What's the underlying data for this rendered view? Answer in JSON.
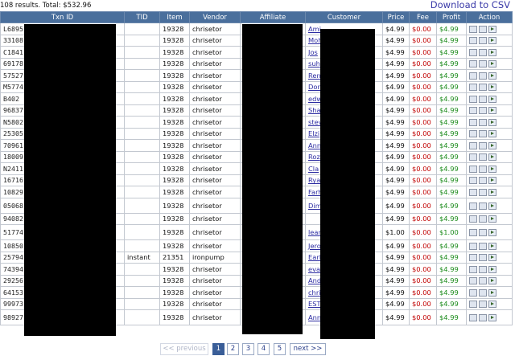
{
  "summary": "108 results. Total: $532.96",
  "download_label": "Download to CSV",
  "columns": [
    "Txn ID",
    "TID",
    "Item",
    "Vendor",
    "Affiliate",
    "Customer",
    "Price",
    "Fee",
    "Profit",
    "Action"
  ],
  "rows": [
    {
      "txn": "L6895",
      "tid": "",
      "item": "19328",
      "vendor": "chrisetor",
      "customer": "Ami",
      "price": "$4.99",
      "fee": "$0.00",
      "profit": "$4.99",
      "tall": false
    },
    {
      "txn": "33108",
      "tid": "",
      "item": "19328",
      "vendor": "chrisetor",
      "customer": "Moh",
      "price": "$4.99",
      "fee": "$0.00",
      "profit": "$4.99",
      "tall": false
    },
    {
      "txn": "C1841",
      "tid": "",
      "item": "19328",
      "vendor": "chrisetor",
      "customer": "Jos",
      "price": "$4.99",
      "fee": "$0.00",
      "profit": "$4.99",
      "tall": false
    },
    {
      "txn": "69178",
      "tid": "",
      "item": "19328",
      "vendor": "chrisetor",
      "customer": "suh",
      "price": "$4.99",
      "fee": "$0.00",
      "profit": "$4.99",
      "tall": false
    },
    {
      "txn": "57527",
      "tid": "",
      "item": "19328",
      "vendor": "chrisetor",
      "customer": "Ren",
      "price": "$4.99",
      "fee": "$0.00",
      "profit": "$4.99",
      "tall": false
    },
    {
      "txn": "M5774",
      "tid": "",
      "item": "19328",
      "vendor": "chrisetor",
      "customer": "Don",
      "price": "$4.99",
      "fee": "$0.00",
      "profit": "$4.99",
      "tall": false
    },
    {
      "txn": "B402",
      "tid": "",
      "item": "19328",
      "vendor": "chrisetor",
      "customer": "edw",
      "price": "$4.99",
      "fee": "$0.00",
      "profit": "$4.99",
      "tall": false
    },
    {
      "txn": "96837",
      "tid": "",
      "item": "19328",
      "vendor": "chrisetor",
      "customer": "Sha",
      "price": "$4.99",
      "fee": "$0.00",
      "profit": "$4.99",
      "tall": false
    },
    {
      "txn": "N5802",
      "tid": "",
      "item": "19328",
      "vendor": "chrisetor",
      "customer": "stev",
      "price": "$4.99",
      "fee": "$0.00",
      "profit": "$4.99",
      "tall": false
    },
    {
      "txn": "25305",
      "tid": "",
      "item": "19328",
      "vendor": "chrisetor",
      "customer": "Elzi",
      "price": "$4.99",
      "fee": "$0.00",
      "profit": "$4.99",
      "tall": false
    },
    {
      "txn": "70961",
      "tid": "",
      "item": "19328",
      "vendor": "chrisetor",
      "customer": "Ann",
      "price": "$4.99",
      "fee": "$0.00",
      "profit": "$4.99",
      "tall": false
    },
    {
      "txn": "18009",
      "tid": "",
      "item": "19328",
      "vendor": "chrisetor",
      "customer": "Roz",
      "price": "$4.99",
      "fee": "$0.00",
      "profit": "$4.99",
      "tall": false
    },
    {
      "txn": "N2411",
      "tid": "",
      "item": "19328",
      "vendor": "chrisetor",
      "customer": "Cla",
      "price": "$4.99",
      "fee": "$0.00",
      "profit": "$4.99",
      "tall": false
    },
    {
      "txn": "16716",
      "tid": "",
      "item": "19328",
      "vendor": "chrisetor",
      "customer": "Rya",
      "price": "$4.99",
      "fee": "$0.00",
      "profit": "$4.99",
      "tall": false
    },
    {
      "txn": "10829",
      "tid": "",
      "item": "19328",
      "vendor": "chrisetor",
      "customer": "Farh",
      "price": "$4.99",
      "fee": "$0.00",
      "profit": "$4.99",
      "tall": false
    },
    {
      "txn": "05068",
      "tid": "",
      "item": "19328",
      "vendor": "chrisetor",
      "customer": "Dim Muh",
      "price": "$4.99",
      "fee": "$0.00",
      "profit": "$4.99",
      "tall": true
    },
    {
      "txn": "94082",
      "tid": "",
      "item": "19328",
      "vendor": "chrisetor",
      "customer": "",
      "price": "$4.99",
      "fee": "$0.00",
      "profit": "$4.99",
      "tall": false
    },
    {
      "txn": "51774",
      "tid": "",
      "item": "19328",
      "vendor": "chrisetor",
      "customer": "lean sant",
      "price": "$1.00",
      "fee": "$0.00",
      "profit": "$1.00",
      "tall": true
    },
    {
      "txn": "10850",
      "tid": "",
      "item": "19328",
      "vendor": "chrisetor",
      "customer": "Jero",
      "price": "$4.99",
      "fee": "$0.00",
      "profit": "$4.99",
      "tall": false
    },
    {
      "txn": "25794",
      "tid": "instant",
      "item": "21351",
      "vendor": "ironpump",
      "customer": "Earl",
      "price": "$4.99",
      "fee": "$0.00",
      "profit": "$4.99",
      "tall": false
    },
    {
      "txn": "74394",
      "tid": "",
      "item": "19328",
      "vendor": "chrisetor",
      "customer": "eva",
      "price": "$4.99",
      "fee": "$0.00",
      "profit": "$4.99",
      "tall": false
    },
    {
      "txn": "29256",
      "tid": "",
      "item": "19328",
      "vendor": "chrisetor",
      "customer": "And",
      "price": "$4.99",
      "fee": "$0.00",
      "profit": "$4.99",
      "tall": false
    },
    {
      "txn": "64153",
      "tid": "",
      "item": "19328",
      "vendor": "chrisetor",
      "customer": "chri",
      "price": "$4.99",
      "fee": "$0.00",
      "profit": "$4.99",
      "tall": false
    },
    {
      "txn": "99973",
      "tid": "",
      "item": "19328",
      "vendor": "chrisetor",
      "customer": "EST",
      "price": "$4.99",
      "fee": "$0.00",
      "profit": "$4.99",
      "tall": false
    },
    {
      "txn": "98927",
      "tid": "",
      "item": "19328",
      "vendor": "chrisetor",
      "customer": "Ann Mel",
      "price": "$4.99",
      "fee": "$0.00",
      "profit": "$4.99",
      "tall": true
    }
  ],
  "pagination": {
    "previous": "<< previous",
    "pages": [
      "1",
      "2",
      "3",
      "4",
      "5"
    ],
    "current": "1",
    "next": "next >>"
  },
  "colors": {
    "header": "#4a6f9c",
    "fee": "#c00000",
    "profit": "#1a8a1a",
    "link": "#2a2aa0",
    "redaction": "#000000"
  }
}
